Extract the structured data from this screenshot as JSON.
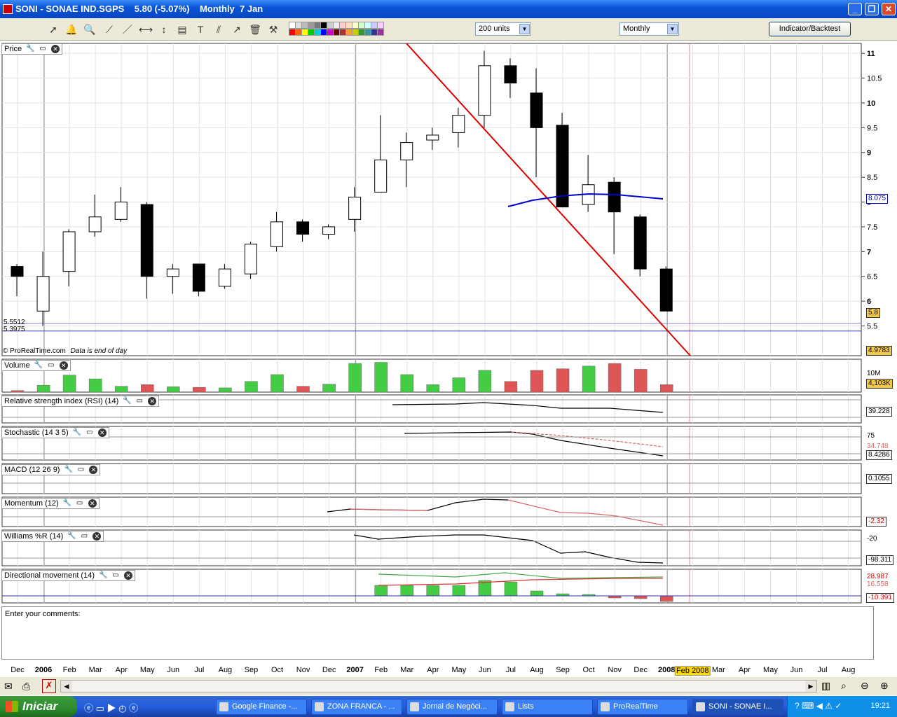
{
  "window": {
    "title": "SONI - SONAE IND.SGPS    5.80 (-5.07%)    Monthly  7 Jan"
  },
  "toolbar": {
    "units_select": "200 units",
    "period_select": "Monthly",
    "indicator_button": "Indicator/Backtest"
  },
  "panels": {
    "price": "Price",
    "volume": "Volume",
    "rsi": "Relative strength index (RSI) (14)",
    "stochastic": "Stochastic (14 3 5)",
    "macd": "MACD (12 26 9)",
    "momentum": "Momentum (12)",
    "williams": "Williams %R (14)",
    "dm": "Directional movement (14)"
  },
  "price_panel": {
    "left_labels": [
      "5.5512",
      "5.3975"
    ],
    "watermark": "© ProRealTime.com",
    "watermark_note": "Data is end of day",
    "value_boxes": {
      "ma": "8.075",
      "last": "5.8",
      "bottom": "4.9783"
    }
  },
  "indicator_values": {
    "volume_scale": "10M",
    "volume_last": "4,103K",
    "rsi_last": "39.228",
    "stoch_a": "75",
    "stoch_b": "34.748",
    "stoch_c": "8.4286",
    "macd_last": "0.1055",
    "momentum_last": "-2.32",
    "williams_a": "-20",
    "williams_b": "-98.311",
    "dm_a": "28.987",
    "dm_b": "16.558",
    "dm_c": "-10.391"
  },
  "comments_placeholder": "Enter your comments:",
  "highlight_label": "Feb 2008",
  "taskbar": {
    "start": "Iniciar",
    "tasks": [
      "Google Finance -...",
      "ZONA FRANCA - ...",
      "Jornal de Negóci...",
      "Lists",
      "ProRealTime",
      "SONI - SONAE I..."
    ],
    "clock": "19:21"
  },
  "colors": {
    "up": "#ffffff",
    "down": "#000000",
    "trend": "#dd0000",
    "ma": "#0000cc",
    "vol_up": "#44cc44",
    "vol_down": "#dd5555"
  },
  "chart_data": {
    "type": "candlestick",
    "title": "SONI - SONAE IND.SGPS",
    "x_labels": [
      "Dec",
      "2006",
      "Feb",
      "Mar",
      "Apr",
      "May",
      "Jun",
      "Jul",
      "Aug",
      "Sep",
      "Oct",
      "Nov",
      "Dec",
      "2007",
      "Feb",
      "Mar",
      "Apr",
      "May",
      "Jun",
      "Jul",
      "Aug",
      "Sep",
      "Oct",
      "Nov",
      "Dec",
      "2008",
      "Feb 2008",
      "Mar",
      "Apr",
      "May",
      "Jun",
      "Jul",
      "Aug"
    ],
    "y_ticks": [
      "5.5",
      "6",
      "6.5",
      "7",
      "7.5",
      "8",
      "8.5",
      "9",
      "9.5",
      "10",
      "10.5",
      "11"
    ],
    "ylim": [
      4.9,
      11.2
    ],
    "candles": [
      {
        "o": 6.7,
        "h": 6.75,
        "l": 6.1,
        "c": 6.5
      },
      {
        "o": 5.8,
        "h": 7.0,
        "l": 5.5,
        "c": 6.5
      },
      {
        "o": 6.6,
        "h": 7.45,
        "l": 6.3,
        "c": 7.4
      },
      {
        "o": 7.4,
        "h": 8.15,
        "l": 7.3,
        "c": 7.7
      },
      {
        "o": 7.65,
        "h": 8.3,
        "l": 7.6,
        "c": 8.0
      },
      {
        "o": 7.95,
        "h": 8.0,
        "l": 6.05,
        "c": 6.5
      },
      {
        "o": 6.5,
        "h": 6.75,
        "l": 6.15,
        "c": 6.65
      },
      {
        "o": 6.75,
        "h": 6.75,
        "l": 6.1,
        "c": 6.2
      },
      {
        "o": 6.3,
        "h": 6.75,
        "l": 6.25,
        "c": 6.65
      },
      {
        "o": 6.55,
        "h": 7.2,
        "l": 6.45,
        "c": 7.15
      },
      {
        "o": 7.1,
        "h": 7.8,
        "l": 7.0,
        "c": 7.6
      },
      {
        "o": 7.6,
        "h": 7.65,
        "l": 7.2,
        "c": 7.35
      },
      {
        "o": 7.35,
        "h": 7.55,
        "l": 7.25,
        "c": 7.5
      },
      {
        "o": 7.65,
        "h": 8.3,
        "l": 7.4,
        "c": 8.1
      },
      {
        "o": 8.2,
        "h": 9.75,
        "l": 8.2,
        "c": 8.85
      },
      {
        "o": 8.85,
        "h": 9.4,
        "l": 8.3,
        "c": 9.2
      },
      {
        "o": 9.25,
        "h": 9.5,
        "l": 9.05,
        "c": 9.35
      },
      {
        "o": 9.4,
        "h": 9.9,
        "l": 9.1,
        "c": 9.75
      },
      {
        "o": 9.75,
        "h": 11.05,
        "l": 9.5,
        "c": 10.75
      },
      {
        "o": 10.75,
        "h": 10.9,
        "l": 10.1,
        "c": 10.4
      },
      {
        "o": 10.2,
        "h": 10.7,
        "l": 8.5,
        "c": 9.5
      },
      {
        "o": 9.55,
        "h": 9.8,
        "l": 7.9,
        "c": 7.9
      },
      {
        "o": 7.95,
        "h": 8.95,
        "l": 7.8,
        "c": 8.35
      },
      {
        "o": 8.4,
        "h": 8.5,
        "l": 6.95,
        "c": 7.8
      },
      {
        "o": 7.7,
        "h": 7.75,
        "l": 6.5,
        "c": 6.65
      },
      {
        "o": 6.65,
        "h": 6.7,
        "l": 5.8,
        "c": 5.8
      }
    ],
    "volume": [
      {
        "v": 0.3,
        "up": false
      },
      {
        "v": 1.3,
        "up": true
      },
      {
        "v": 3.2,
        "up": true
      },
      {
        "v": 2.5,
        "up": true
      },
      {
        "v": 1.1,
        "up": true
      },
      {
        "v": 1.4,
        "up": false
      },
      {
        "v": 1.0,
        "up": true
      },
      {
        "v": 0.9,
        "up": false
      },
      {
        "v": 0.8,
        "up": true
      },
      {
        "v": 2.0,
        "up": true
      },
      {
        "v": 3.3,
        "up": true
      },
      {
        "v": 1.1,
        "up": false
      },
      {
        "v": 1.5,
        "up": true
      },
      {
        "v": 5.4,
        "up": true
      },
      {
        "v": 5.6,
        "up": true
      },
      {
        "v": 3.3,
        "up": true
      },
      {
        "v": 1.4,
        "up": true
      },
      {
        "v": 2.7,
        "up": true
      },
      {
        "v": 4.1,
        "up": true
      },
      {
        "v": 2.0,
        "up": false
      },
      {
        "v": 4.1,
        "up": false
      },
      {
        "v": 4.4,
        "up": false
      },
      {
        "v": 4.9,
        "up": true
      },
      {
        "v": 5.4,
        "up": false
      },
      {
        "v": 4.3,
        "up": false
      },
      {
        "v": 1.4,
        "up": false
      }
    ]
  }
}
